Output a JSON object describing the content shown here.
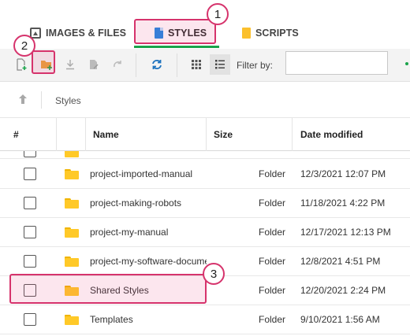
{
  "tabs": [
    {
      "label": "IMAGES & FILES",
      "icon": "image-icon"
    },
    {
      "label": "STYLES",
      "icon": "stylesheet-file-icon",
      "active": true
    },
    {
      "label": "SCRIPTS",
      "icon": "script-file-icon"
    }
  ],
  "colors": {
    "accent": "#1aa34a",
    "callout": "#d6336c",
    "folder": "#ffc928"
  },
  "callouts": [
    "1",
    "2",
    "3"
  ],
  "toolbar": {
    "filter_label": "Filter by:",
    "filter_value": "",
    "icons": [
      "new-file-icon",
      "new-folder-icon",
      "download-icon",
      "rename-icon",
      "redo-icon",
      "refresh-icon",
      "grid-view-icon",
      "list-view-icon"
    ]
  },
  "breadcrumb": {
    "path": "Styles"
  },
  "table": {
    "headers": {
      "select": "#",
      "name": "Name",
      "size": "Size",
      "date": "Date modified"
    },
    "rows": [
      {
        "name": "project-imported-manual",
        "size": "Folder",
        "date": "12/3/2021 12:07 PM"
      },
      {
        "name": "project-making-robots",
        "size": "Folder",
        "date": "11/18/2021 4:22 PM"
      },
      {
        "name": "project-my-manual",
        "size": "Folder",
        "date": "12/17/2021 12:13 PM"
      },
      {
        "name": "project-my-software-documentation",
        "size": "Folder",
        "date": "12/8/2021 4:51 PM"
      },
      {
        "name": "Shared Styles",
        "size": "Folder",
        "date": "12/20/2021 2:24 PM",
        "highlighted": true
      },
      {
        "name": "Templates",
        "size": "Folder",
        "date": "9/10/2021 1:56 AM"
      }
    ]
  }
}
